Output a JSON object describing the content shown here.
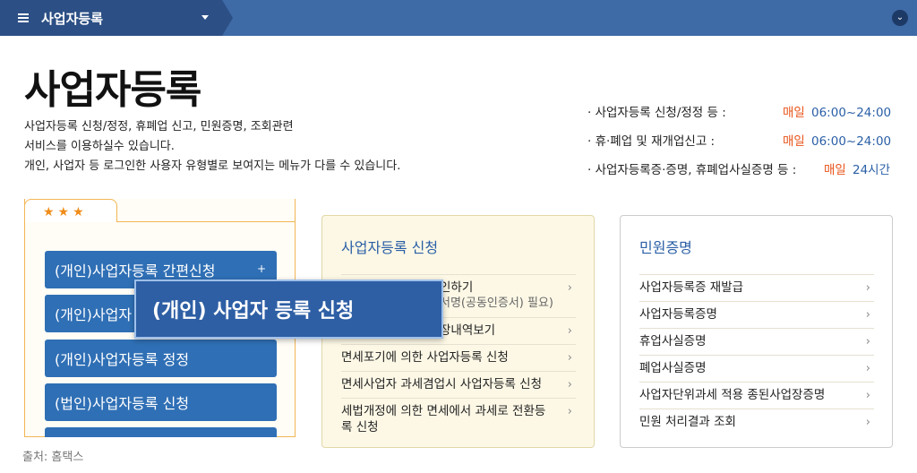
{
  "topbar": {
    "breadcrumb": "사업자등록",
    "menu_icon": "hamburger-icon",
    "dropdown_icon": "caret-down-icon",
    "expand_icon": "chevron-down-circle-icon"
  },
  "page": {
    "title": "사업자등록",
    "description": [
      "사업자등록 신청/정정, 휴폐업 신고, 민원증명, 조회관련",
      "서비스를 이용하실수 있습니다.",
      "개인, 사업자 등 로그인한 사용자 유형별로 보여지는 메뉴가 다를 수 있습니다."
    ]
  },
  "hours": [
    {
      "label": "· 사업자등록 신청/정정 등 :",
      "day": "매일",
      "time": "06:00~24:00"
    },
    {
      "label": "· 휴·폐업 및 재개업신고 :",
      "day": "매일",
      "time": "06:00~24:00"
    },
    {
      "label": "· 사업자등록증·증명, 휴폐업사실증명 등 :",
      "day": "매일",
      "time": "24시간"
    }
  ],
  "left_card": {
    "stars": "★★★",
    "buttons": [
      "(개인)사업자등록 간편신청",
      "(개인)사업자",
      "(개인)사업자등록 정정",
      "(법인)사업자등록 신청"
    ],
    "plus": "+"
  },
  "highlight": "(개인) 사업자 등록 신청",
  "mid_panel": {
    "title": "사업자등록 신청",
    "items": [
      {
        "label": "인하기",
        "sub": "서명(공동인증서) 필요)"
      },
      {
        "label": "장내역보기",
        "sub": ""
      },
      {
        "label": "면세포기에 의한 사업자등록 신청",
        "sub": ""
      },
      {
        "label": "면세사업자 과세겸업시 사업자등록 신청",
        "sub": ""
      },
      {
        "label": "세법개정에 의한 면세에서 과세로 전환등록 신청",
        "sub": ""
      }
    ]
  },
  "right_panel": {
    "title": "민원증명",
    "items": [
      "사업자등록증 재발급",
      "사업자등록증명",
      "휴업사실증명",
      "폐업사실증명",
      "사업자단위과세 적용 종된사업장증명",
      "민원 처리결과 조회"
    ]
  },
  "arrow": "›",
  "source": "출처: 홈택스"
}
